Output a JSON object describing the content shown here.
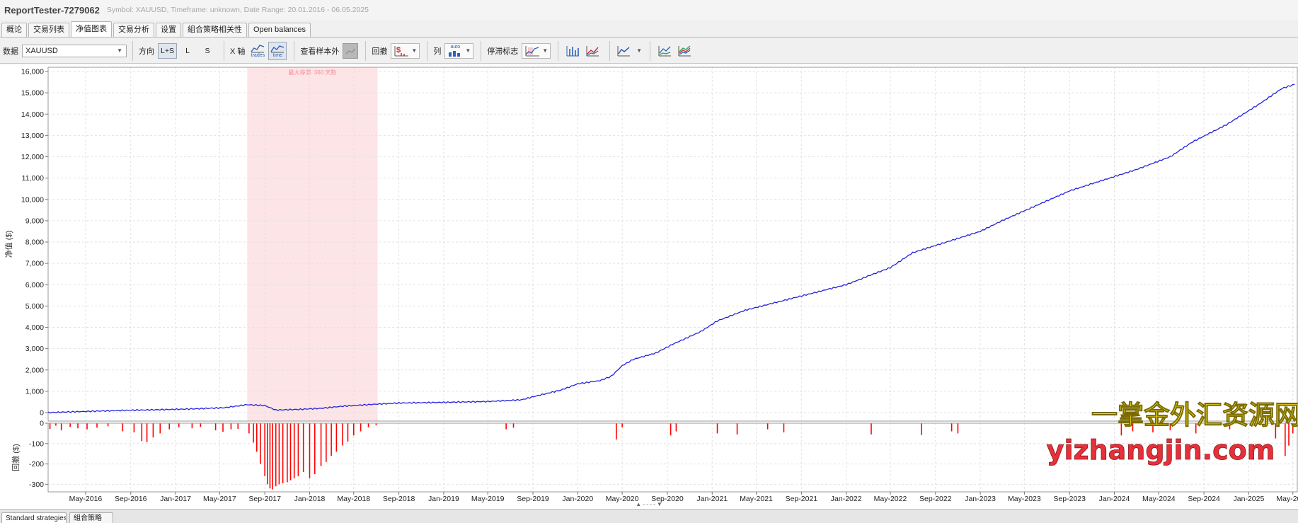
{
  "window": {
    "title": "ReportTester-7279062",
    "subtitle": "Symbol: XAUUSD, Timeframe: unknown, Date Range: 20.01.2016 - 06.05.2025"
  },
  "tabs": [
    {
      "label": "概论",
      "active": false
    },
    {
      "label": "交易列表",
      "active": false
    },
    {
      "label": "净值图表",
      "active": true
    },
    {
      "label": "交易分析",
      "active": false
    },
    {
      "label": "设置",
      "active": false
    },
    {
      "label": "組合策略相关性",
      "active": false
    },
    {
      "label": "Open balances",
      "active": false
    }
  ],
  "toolbar": {
    "data_label": "数据",
    "data_value": "XAUUSD",
    "direction_label": "方向",
    "direction_options": [
      "L+S",
      "L",
      "S"
    ],
    "xaxis_label": "X 轴",
    "xaxis_trades": "trades",
    "xaxis_time": "time",
    "oos_label": "查看样本外",
    "drawdown_label": "回撤",
    "columns_label": "列",
    "columns_auto": "auto",
    "stagnation_label": "停滞标志"
  },
  "chart_data": [
    {
      "type": "line",
      "ylabel": "净值 ($)",
      "ylim": [
        0,
        16000
      ],
      "yticks": [
        0,
        1000,
        2000,
        3000,
        4000,
        5000,
        6000,
        7000,
        8000,
        9000,
        10000,
        11000,
        12000,
        13000,
        14000,
        15000,
        16000
      ],
      "ytick_labels": [
        "0",
        "1,000",
        "2,000",
        "3,000",
        "4,000",
        "5,000",
        "6,000",
        "7,000",
        "8,000",
        "9,000",
        "10,000",
        "11,000",
        "12,000",
        "13,000",
        "14,000",
        "15,000",
        "16,000"
      ],
      "grid": true,
      "line_color": "#2222dd",
      "stagnation": {
        "start": "2017-07-15",
        "end": "2018-07-05",
        "label": "最大停滞: 360 天数",
        "color": "#fde4e6"
      },
      "series": [
        {
          "points": [
            [
              "2016-01-20",
              0
            ],
            [
              "2016-03-15",
              30
            ],
            [
              "2016-06-01",
              70
            ],
            [
              "2016-09-01",
              110
            ],
            [
              "2016-12-01",
              140
            ],
            [
              "2017-03-01",
              180
            ],
            [
              "2017-05-15",
              230
            ],
            [
              "2017-07-15",
              370
            ],
            [
              "2017-09-01",
              330
            ],
            [
              "2017-10-01",
              120
            ],
            [
              "2017-12-01",
              150
            ],
            [
              "2018-02-01",
              200
            ],
            [
              "2018-04-01",
              300
            ],
            [
              "2018-07-05",
              400
            ],
            [
              "2018-09-01",
              450
            ],
            [
              "2019-01-01",
              480
            ],
            [
              "2019-05-01",
              520
            ],
            [
              "2019-08-01",
              600
            ],
            [
              "2019-09-15",
              800
            ],
            [
              "2019-11-15",
              1050
            ],
            [
              "2020-01-01",
              1350
            ],
            [
              "2020-03-01",
              1500
            ],
            [
              "2020-04-01",
              1700
            ],
            [
              "2020-05-01",
              2200
            ],
            [
              "2020-06-01",
              2500
            ],
            [
              "2020-08-01",
              2800
            ],
            [
              "2020-09-15",
              3200
            ],
            [
              "2020-12-01",
              3800
            ],
            [
              "2021-01-15",
              4300
            ],
            [
              "2021-04-01",
              4800
            ],
            [
              "2021-07-01",
              5200
            ],
            [
              "2021-10-01",
              5600
            ],
            [
              "2022-01-01",
              6000
            ],
            [
              "2022-03-01",
              6400
            ],
            [
              "2022-05-01",
              6800
            ],
            [
              "2022-07-01",
              7500
            ],
            [
              "2022-10-01",
              8000
            ],
            [
              "2023-01-01",
              8500
            ],
            [
              "2023-03-01",
              9000
            ],
            [
              "2023-06-01",
              9700
            ],
            [
              "2023-09-01",
              10400
            ],
            [
              "2023-12-01",
              10900
            ],
            [
              "2024-03-01",
              11400
            ],
            [
              "2024-06-01",
              12000
            ],
            [
              "2024-08-01",
              12700
            ],
            [
              "2024-11-01",
              13500
            ],
            [
              "2025-02-01",
              14500
            ],
            [
              "2025-04-01",
              15200
            ],
            [
              "2025-05-06",
              15400
            ]
          ]
        }
      ]
    },
    {
      "type": "bar",
      "ylabel": "回撤 ($)",
      "ylim": [
        -330,
        0
      ],
      "yticks": [
        0,
        -100,
        -200,
        -300
      ],
      "ytick_labels": [
        "0",
        "-100",
        "-200",
        "-300"
      ],
      "grid": true,
      "bar_color": "#ff0000",
      "series": [
        {
          "points": [
            [
              "2016-01-25",
              -28
            ],
            [
              "2016-02-10",
              -12
            ],
            [
              "2016-02-25",
              -35
            ],
            [
              "2016-03-20",
              -18
            ],
            [
              "2016-04-10",
              -25
            ],
            [
              "2016-05-05",
              -30
            ],
            [
              "2016-06-01",
              -22
            ],
            [
              "2016-07-01",
              -15
            ],
            [
              "2016-08-10",
              -40
            ],
            [
              "2016-09-10",
              -45
            ],
            [
              "2016-10-01",
              -88
            ],
            [
              "2016-10-15",
              -92
            ],
            [
              "2016-11-01",
              -70
            ],
            [
              "2016-11-20",
              -50
            ],
            [
              "2016-12-15",
              -30
            ],
            [
              "2017-01-10",
              -20
            ],
            [
              "2017-02-15",
              -25
            ],
            [
              "2017-03-10",
              -18
            ],
            [
              "2017-04-20",
              -35
            ],
            [
              "2017-05-10",
              -42
            ],
            [
              "2017-06-01",
              -30
            ],
            [
              "2017-06-20",
              -28
            ],
            [
              "2017-07-20",
              -50
            ],
            [
              "2017-08-01",
              -95
            ],
            [
              "2017-08-10",
              -140
            ],
            [
              "2017-08-20",
              -200
            ],
            [
              "2017-09-01",
              -260
            ],
            [
              "2017-09-08",
              -300
            ],
            [
              "2017-09-15",
              -320
            ],
            [
              "2017-09-22",
              -325
            ],
            [
              "2017-10-01",
              -310
            ],
            [
              "2017-10-10",
              -300
            ],
            [
              "2017-10-20",
              -295
            ],
            [
              "2017-11-01",
              -290
            ],
            [
              "2017-11-10",
              -280
            ],
            [
              "2017-11-20",
              -270
            ],
            [
              "2017-12-01",
              -260
            ],
            [
              "2017-12-15",
              -240
            ],
            [
              "2018-01-01",
              -270
            ],
            [
              "2018-01-15",
              -250
            ],
            [
              "2018-02-01",
              -210
            ],
            [
              "2018-02-15",
              -190
            ],
            [
              "2018-03-01",
              -160
            ],
            [
              "2018-03-15",
              -140
            ],
            [
              "2018-04-01",
              -110
            ],
            [
              "2018-04-15",
              -90
            ],
            [
              "2018-05-01",
              -60
            ],
            [
              "2018-05-20",
              -40
            ],
            [
              "2018-06-10",
              -20
            ],
            [
              "2018-07-01",
              -10
            ],
            [
              "2019-06-20",
              -30
            ],
            [
              "2019-07-10",
              -22
            ],
            [
              "2020-04-15",
              -80
            ],
            [
              "2020-05-01",
              -20
            ],
            [
              "2020-09-10",
              -60
            ],
            [
              "2020-09-25",
              -40
            ],
            [
              "2021-01-15",
              -50
            ],
            [
              "2021-03-10",
              -55
            ],
            [
              "2021-06-01",
              -30
            ],
            [
              "2021-07-15",
              -45
            ],
            [
              "2022-03-10",
              -55
            ],
            [
              "2022-07-25",
              -58
            ],
            [
              "2022-10-15",
              -40
            ],
            [
              "2022-11-01",
              -50
            ],
            [
              "2024-01-20",
              -60
            ],
            [
              "2024-02-20",
              -40
            ],
            [
              "2024-04-15",
              -45
            ],
            [
              "2024-06-01",
              -35
            ],
            [
              "2024-08-10",
              -50
            ],
            [
              "2024-11-10",
              -30
            ],
            [
              "2025-03-15",
              -75
            ],
            [
              "2025-04-10",
              -160
            ],
            [
              "2025-04-20",
              -110
            ],
            [
              "2025-05-01",
              -50
            ]
          ]
        }
      ]
    }
  ],
  "x_axis": {
    "tick_labels": [
      "May-2016",
      "Sep-2016",
      "Jan-2017",
      "May-2017",
      "Sep-2017",
      "Jan-2018",
      "May-2018",
      "Sep-2018",
      "Jan-2019",
      "May-2019",
      "Sep-2019",
      "Jan-2020",
      "May-2020",
      "Sep-2020",
      "Jan-2021",
      "May-2021",
      "Sep-2021",
      "Jan-2022",
      "May-2022",
      "Sep-2022",
      "Jan-2023",
      "May-2023",
      "Sep-2023",
      "Jan-2024",
      "May-2024",
      "Sep-2024",
      "Jan-2025",
      "May-2025"
    ],
    "tick_dates": [
      "2016-05-01",
      "2016-09-01",
      "2017-01-01",
      "2017-05-01",
      "2017-09-01",
      "2018-01-01",
      "2018-05-01",
      "2018-09-01",
      "2019-01-01",
      "2019-05-01",
      "2019-09-01",
      "2020-01-01",
      "2020-05-01",
      "2020-09-01",
      "2021-01-01",
      "2021-05-01",
      "2021-09-01",
      "2022-01-01",
      "2022-05-01",
      "2022-09-01",
      "2023-01-01",
      "2023-05-01",
      "2023-09-01",
      "2024-01-01",
      "2024-05-01",
      "2024-09-01",
      "2025-01-01",
      "2025-05-01"
    ],
    "range": [
      "2016-01-20",
      "2025-05-15"
    ]
  },
  "watermark": {
    "line1": "一掌金外汇资源网",
    "line2": "yizhangjin.com",
    "color_line1": "#f2dc1d",
    "color_line2": "#e6303a"
  },
  "splitter_glyph": "▲ - - - - ▼",
  "bottom_tabs": [
    "Standard strategies",
    "組合策略"
  ]
}
